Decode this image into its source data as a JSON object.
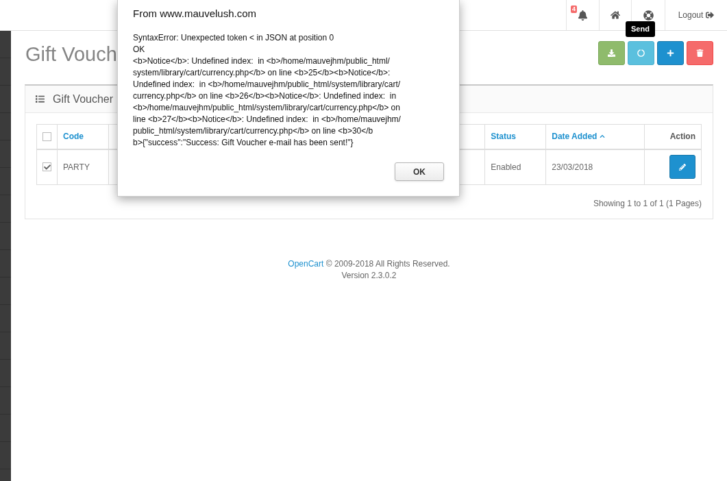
{
  "header": {
    "notifications": {
      "count": "4"
    },
    "logout": {
      "label": "Logout"
    }
  },
  "page": {
    "title": "Gift Vouch"
  },
  "toolbar": {
    "buttons": [
      {
        "kind": "download"
      },
      {
        "kind": "send"
      },
      {
        "kind": "add"
      },
      {
        "kind": "delete"
      }
    ],
    "tooltip": "Send"
  },
  "panel": {
    "title": "Gift Voucher",
    "table": {
      "select_all": {
        "checked": false
      },
      "columns": [
        {
          "kind": "text",
          "label": "Code",
          "sorted": false
        },
        {
          "kind": "hidden"
        },
        {
          "kind": "text",
          "label": "Status",
          "sorted": false
        },
        {
          "kind": "text",
          "label": "Date Added",
          "sorted": true
        },
        {
          "kind": "action",
          "label": "Action"
        }
      ],
      "rows": [
        {
          "checked": true,
          "cells": [
            "PARTY",
            null,
            "Enabled",
            "23/03/2018"
          ]
        }
      ]
    },
    "pagination": "Showing 1 to 1 of 1 (1 Pages)"
  },
  "footer": {
    "link": "OpenCart",
    "text": "© 2009-2018 All Rights Reserved.",
    "version": "Version 2.3.0.2"
  },
  "dialog": {
    "title": "From www.mauvelush.com",
    "message_lines": [
      "SyntaxError: Unexpected token < in JSON at position 0",
      "OK",
      "<b>Notice</b>: Undefined index:  in <b>/home/mauvejhm/public_html/",
      "system/library/cart/currency.php</b> on line <b>25</b><b>Notice</b>:",
      "Undefined index:  in <b>/home/mauvejhm/public_html/system/library/cart/",
      "currency.php</b> on line <b>26</b><b>Notice</b>: Undefined index:  in",
      "<b>/home/mauvejhm/public_html/system/library/cart/currency.php</b> on",
      "line <b>27</b><b>Notice</b>: Undefined index:  in <b>/home/mauvejhm/",
      "public_html/system/library/cart/currency.php</b> on line <b>30</b",
      "b>{\"success\":\"Success: Gift Voucher e-mail has been sent!\"}"
    ],
    "button": "OK"
  }
}
